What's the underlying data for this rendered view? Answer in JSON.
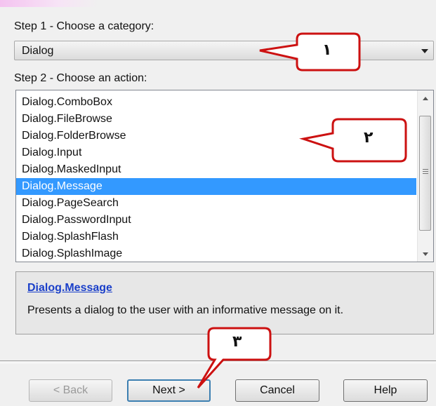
{
  "step1": {
    "label": "Step 1 - Choose a category:",
    "selected_category": "Dialog"
  },
  "step2": {
    "label": "Step 2 - Choose an action:",
    "actions": [
      "Dialog.ComboBox",
      "Dialog.FileBrowse",
      "Dialog.FolderBrowse",
      "Dialog.Input",
      "Dialog.MaskedInput",
      "Dialog.Message",
      "Dialog.PageSearch",
      "Dialog.PasswordInput",
      "Dialog.SplashFlash",
      "Dialog.SplashImage"
    ],
    "selected_index": 5
  },
  "description": {
    "title": "Dialog.Message",
    "text": "Presents a dialog to the user with an informative message on it."
  },
  "buttons": {
    "back": "< Back",
    "next": "Next >",
    "cancel": "Cancel",
    "help": "Help"
  },
  "annotations": {
    "callout_1": "١",
    "callout_2": "٢",
    "callout_3": "٣"
  },
  "colors": {
    "selection": "#3399ff",
    "callout_stroke": "#cc1111",
    "link": "#1a3fc9"
  }
}
